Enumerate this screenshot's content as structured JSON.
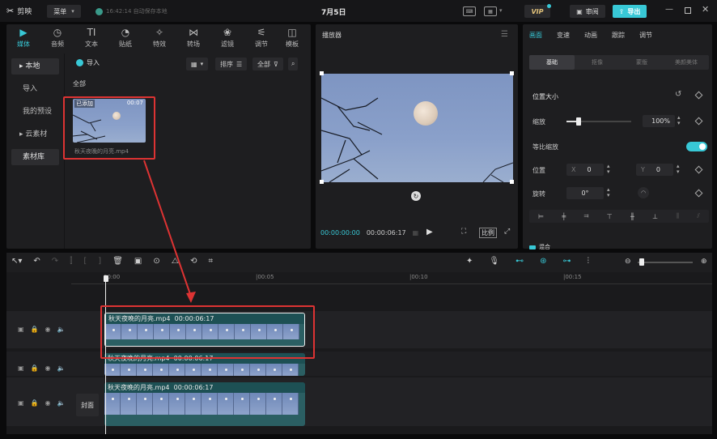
{
  "titlebar": {
    "app_name": "剪映",
    "menu_label": "菜单",
    "autosave_text": "16:42:14 自动保存本地",
    "project_title": "7月5日",
    "vip_label": "VIP",
    "review_label": "审阅",
    "export_label": "导出"
  },
  "media_tabs": [
    {
      "label": "媒体",
      "icon": "media-icon"
    },
    {
      "label": "音频",
      "icon": "audio-icon"
    },
    {
      "label": "文本",
      "icon": "text-icon"
    },
    {
      "label": "贴纸",
      "icon": "sticker-icon"
    },
    {
      "label": "特效",
      "icon": "effects-icon"
    },
    {
      "label": "转场",
      "icon": "transition-icon"
    },
    {
      "label": "滤镜",
      "icon": "filter-icon"
    },
    {
      "label": "调节",
      "icon": "adjust-icon"
    },
    {
      "label": "模板",
      "icon": "template-icon"
    }
  ],
  "sidebar": {
    "local": "本地",
    "import": "导入",
    "my_presets": "我的预设",
    "cloud": "云素材",
    "library": "素材库"
  },
  "media_panel": {
    "import_label": "导入",
    "sort_label": "排序",
    "all_filter_label": "全部",
    "section_title": "全部",
    "item": {
      "badge": "已添加",
      "duration": "00:07",
      "filename": "秋天夜晚的月亮.mp4"
    }
  },
  "player": {
    "title": "播放器",
    "current_time": "00:00:00:00",
    "total_time": "00:00:06:17",
    "ratio_label": "比例"
  },
  "inspector": {
    "tabs": [
      "画面",
      "变速",
      "动画",
      "跟踪",
      "调节"
    ],
    "subtabs": [
      "基础",
      "抠像",
      "蒙版",
      "美颜美体"
    ],
    "section_position": "位置大小",
    "scale_label": "缩放",
    "scale_value": "100%",
    "uniform_scale_label": "等比缩放",
    "position_label": "位置",
    "pos_x_label": "X",
    "pos_x_value": "0",
    "pos_y_label": "Y",
    "pos_y_value": "0",
    "rotate_label": "旋转",
    "rotate_value": "0°",
    "next_section": "混合"
  },
  "timeline": {
    "ruler": [
      "00:00",
      "|00:05",
      "|00:10",
      "|00:15"
    ],
    "clips": [
      {
        "label": "秋天夜晚的月亮.mp4",
        "time": "00:00:06:17"
      },
      {
        "label": "秋天夜晚的月亮.mp4",
        "time": "00:00:06:17"
      },
      {
        "label": "秋天夜晚的月亮.mp4",
        "time": "00:00:06:17"
      }
    ],
    "cover_label": "封面"
  },
  "colors": {
    "accent": "#38c8d6",
    "annotation": "#d33333",
    "panel": "#1e1e20"
  }
}
